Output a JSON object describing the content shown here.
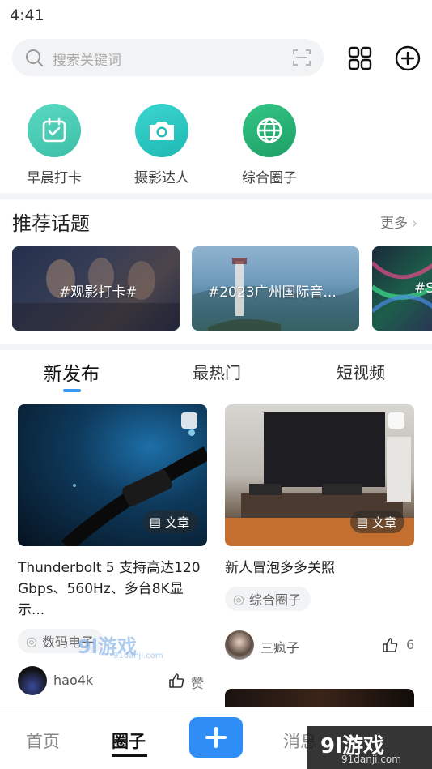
{
  "status_bar": {
    "time": "4:41"
  },
  "search": {
    "placeholder": "搜索关键词"
  },
  "quick_actions": [
    {
      "label": "早晨打卡",
      "icon": "calendar-check-icon",
      "color": "#4fcfb6"
    },
    {
      "label": "摄影达人",
      "icon": "camera-icon",
      "color": "#2cc7c0"
    },
    {
      "label": "综合圈子",
      "icon": "globe-icon",
      "color": "#27b57a"
    }
  ],
  "topics": {
    "title": "推荐话题",
    "more": "更多",
    "items": [
      {
        "label": "#观影打卡#"
      },
      {
        "label": "#2023广州国际音..."
      },
      {
        "label": "#S"
      }
    ]
  },
  "tabs": [
    {
      "label": "新发布",
      "active": true
    },
    {
      "label": "最热门",
      "active": false
    },
    {
      "label": "短视频",
      "active": false
    }
  ],
  "posts": [
    {
      "title": "Thunderbolt 5 支持高达120 Gbps、560Hz、多台8K显示...",
      "type": "文章",
      "circle": "数码电子",
      "author": "hao4k",
      "likes": "赞"
    },
    {
      "title": "新人冒泡多多关照",
      "type": "文章",
      "circle": "综合圈子",
      "author": "三疯子",
      "likes": "6"
    }
  ],
  "bottom_nav": {
    "home": "首页",
    "circle": "圈子",
    "messages": "消息"
  },
  "watermark": {
    "text": "9l游戏",
    "url": "91danji.com"
  },
  "colors": {
    "accent": "#2f8ef5",
    "tab_indicator": "#3a9bf0"
  }
}
